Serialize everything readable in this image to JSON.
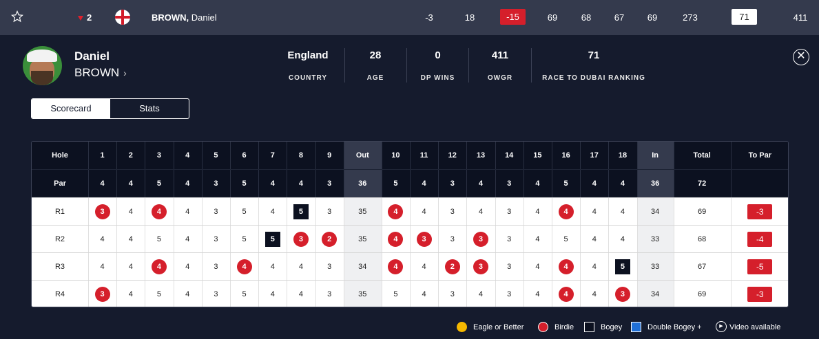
{
  "top_row": {
    "movement": "2",
    "last_name": "BROWN,",
    "first_name": "Daniel",
    "to_par": "-3",
    "thru": "18",
    "position": "-15",
    "rounds": [
      "69",
      "68",
      "67",
      "69"
    ],
    "total": "273",
    "race_rank": "71",
    "owgr": "411"
  },
  "profile": {
    "first_name": "Daniel",
    "last_name": "BROWN",
    "stats": [
      {
        "value": "England",
        "label": "COUNTRY"
      },
      {
        "value": "28",
        "label": "AGE"
      },
      {
        "value": "0",
        "label": "DP WINS"
      },
      {
        "value": "411",
        "label": "OWGR"
      },
      {
        "value": "71",
        "label": "RACE TO DUBAI RANKING"
      }
    ]
  },
  "tabs": {
    "scorecard": "Scorecard",
    "stats": "Stats"
  },
  "scorecard": {
    "headers": {
      "hole": "Hole",
      "par": "Par",
      "out": "Out",
      "in": "In",
      "total": "Total",
      "to_par": "To Par"
    },
    "holes": [
      "1",
      "2",
      "3",
      "4",
      "5",
      "6",
      "7",
      "8",
      "9",
      "10",
      "11",
      "12",
      "13",
      "14",
      "15",
      "16",
      "17",
      "18"
    ],
    "pars": [
      "4",
      "4",
      "5",
      "4",
      "3",
      "5",
      "4",
      "4",
      "3",
      "5",
      "4",
      "3",
      "4",
      "3",
      "4",
      "5",
      "4",
      "4"
    ],
    "par_out": "36",
    "par_in": "36",
    "par_total": "72",
    "rounds": [
      {
        "label": "R1",
        "scores": [
          "3",
          "4",
          "4",
          "4",
          "3",
          "5",
          "4",
          "5",
          "3",
          "4",
          "4",
          "3",
          "4",
          "3",
          "4",
          "4",
          "4",
          "4"
        ],
        "out": "35",
        "in": "34",
        "total": "69",
        "to_par": "-3"
      },
      {
        "label": "R2",
        "scores": [
          "4",
          "4",
          "5",
          "4",
          "3",
          "5",
          "5",
          "3",
          "2",
          "4",
          "3",
          "3",
          "3",
          "3",
          "4",
          "5",
          "4",
          "4"
        ],
        "out": "35",
        "in": "33",
        "total": "68",
        "to_par": "-4"
      },
      {
        "label": "R3",
        "scores": [
          "4",
          "4",
          "4",
          "4",
          "3",
          "4",
          "4",
          "4",
          "3",
          "4",
          "4",
          "2",
          "3",
          "3",
          "4",
          "4",
          "4",
          "5"
        ],
        "out": "34",
        "in": "33",
        "total": "67",
        "to_par": "-5"
      },
      {
        "label": "R4",
        "scores": [
          "3",
          "4",
          "5",
          "4",
          "3",
          "5",
          "4",
          "4",
          "3",
          "5",
          "4",
          "3",
          "4",
          "3",
          "4",
          "4",
          "4",
          "3"
        ],
        "out": "35",
        "in": "34",
        "total": "69",
        "to_par": "-3"
      }
    ]
  },
  "legend": {
    "eagle": "Eagle or Better",
    "birdie": "Birdie",
    "bogey": "Bogey",
    "double": "Double Bogey +",
    "video": "Video available"
  },
  "colors": {
    "eagle": "#f5b800",
    "birdie": "#d51f2b",
    "bogey": "#0c1120",
    "double": "#1f6fd6"
  }
}
